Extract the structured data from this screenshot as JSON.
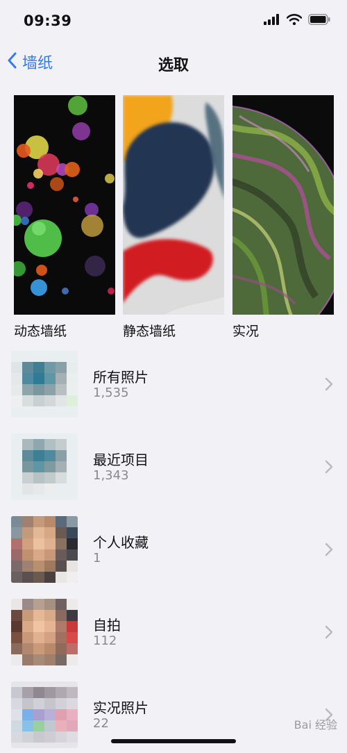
{
  "status_bar": {
    "time": "09:39"
  },
  "nav": {
    "back_label": "墙纸",
    "title": "选取"
  },
  "wallpaper_categories": [
    {
      "label": "动态墙纸"
    },
    {
      "label": "静态墙纸"
    },
    {
      "label": "实况"
    }
  ],
  "albums": [
    {
      "title": "所有照片",
      "count": "1,535"
    },
    {
      "title": "最近项目",
      "count": "1,343"
    },
    {
      "title": "个人收藏",
      "count": "1"
    },
    {
      "title": "自拍",
      "count": "112"
    },
    {
      "title": "实况照片",
      "count": "22"
    }
  ],
  "watermark": "Bai 经验",
  "colors": {
    "accent": "#3478f6",
    "background": "#f2f1f6",
    "secondary_text": "#8a8a8e"
  }
}
